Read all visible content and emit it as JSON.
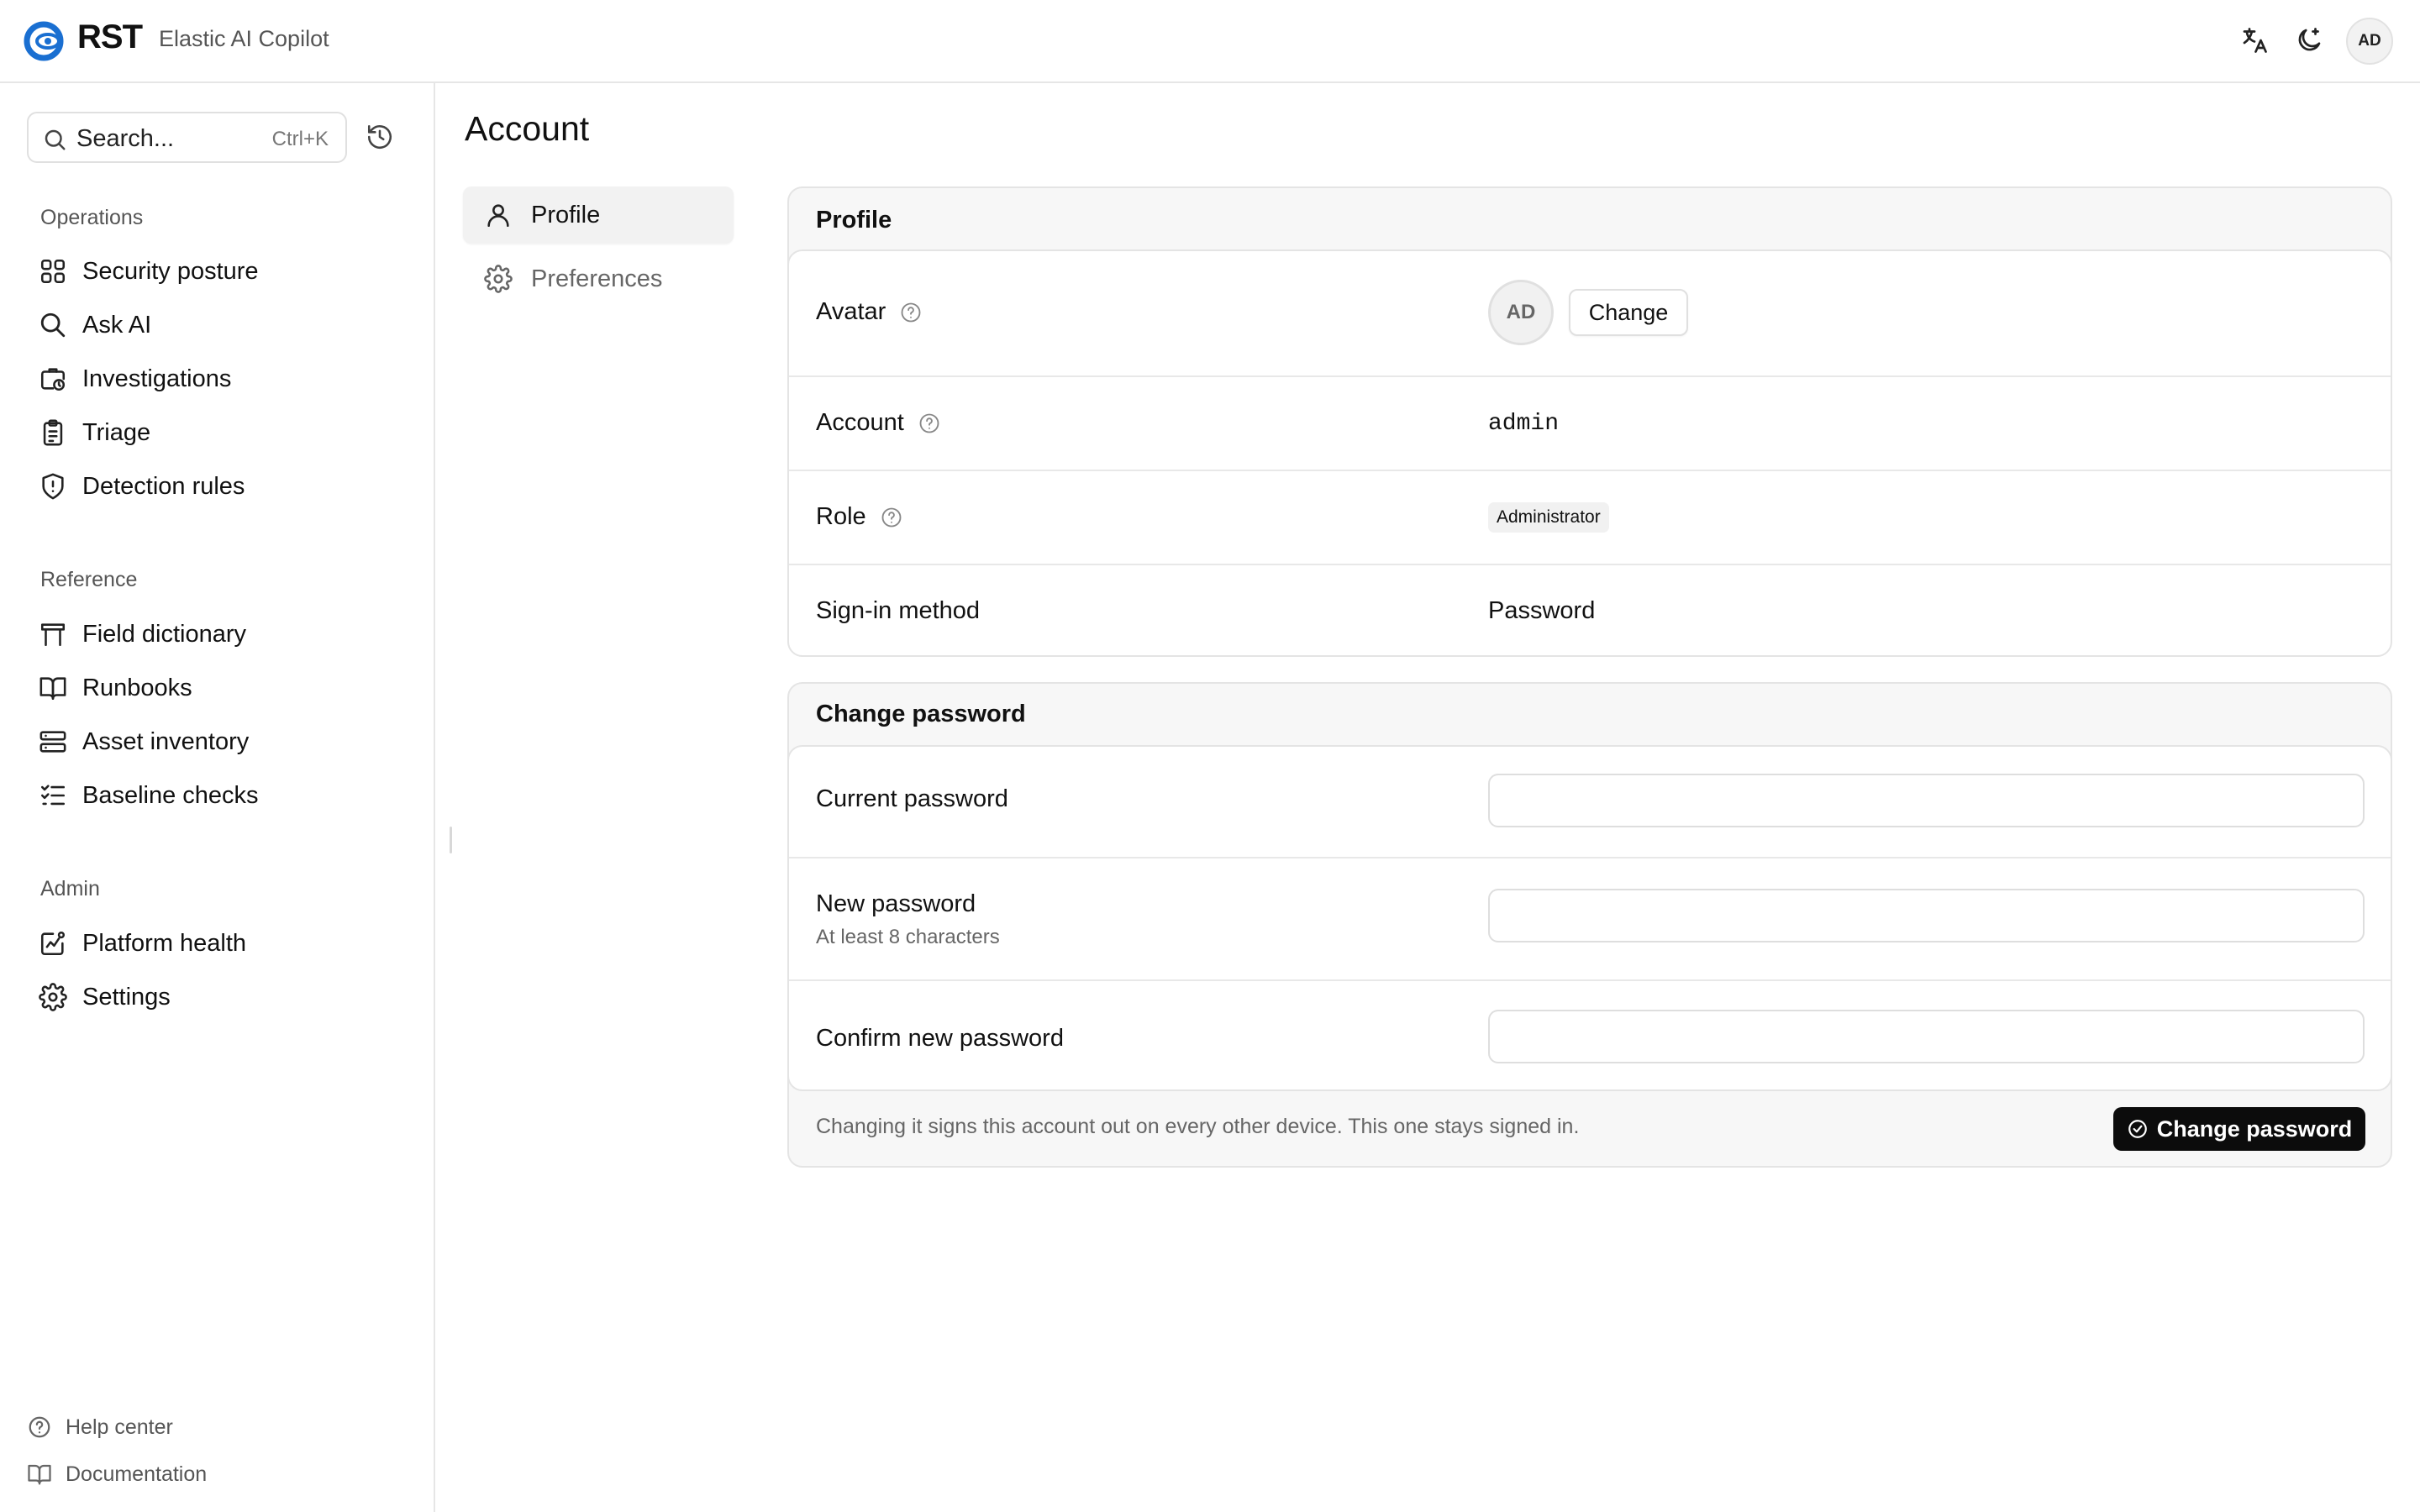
{
  "header": {
    "logo_text": "RST",
    "app_name": "Elastic AI Copilot",
    "icons": [
      "translate-icon",
      "theme-toggle-icon"
    ],
    "user_initials": "AD"
  },
  "sidebar": {
    "search": {
      "placeholder": "Search...",
      "shortcut": "Ctrl+K"
    },
    "sections": [
      {
        "label": "Operations",
        "items": [
          {
            "label": "Security posture",
            "icon": "grid-icon"
          },
          {
            "label": "Ask AI",
            "icon": "search-icon"
          },
          {
            "label": "Investigations",
            "icon": "investigation-icon"
          },
          {
            "label": "Triage",
            "icon": "clipboard-icon"
          },
          {
            "label": "Detection rules",
            "icon": "shield-alert-icon"
          }
        ]
      },
      {
        "label": "Reference",
        "items": [
          {
            "label": "Field dictionary",
            "icon": "table-icon"
          },
          {
            "label": "Runbooks",
            "icon": "book-icon"
          },
          {
            "label": "Asset inventory",
            "icon": "server-icon"
          },
          {
            "label": "Baseline checks",
            "icon": "checklist-icon"
          }
        ]
      },
      {
        "label": "Admin",
        "items": [
          {
            "label": "Platform health",
            "icon": "health-chart-icon"
          },
          {
            "label": "Settings",
            "icon": "gear-icon"
          }
        ]
      }
    ],
    "footer": [
      {
        "label": "Help center",
        "icon": "help-circle-icon"
      },
      {
        "label": "Documentation",
        "icon": "book-open-icon"
      }
    ]
  },
  "main": {
    "title": "Account",
    "subnav": [
      {
        "label": "Profile",
        "icon": "user-icon",
        "active": true
      },
      {
        "label": "Preferences",
        "icon": "gear-icon",
        "active": false
      }
    ],
    "profile_card": {
      "title": "Profile",
      "avatar": {
        "label": "Avatar",
        "initials": "AD",
        "button": "Change"
      },
      "account": {
        "label": "Account",
        "value": "admin"
      },
      "role": {
        "label": "Role",
        "value": "Administrator"
      },
      "signin": {
        "label": "Sign-in method",
        "value": "Password"
      }
    },
    "password_card": {
      "title": "Change password",
      "current": {
        "label": "Current password",
        "value": ""
      },
      "new": {
        "label": "New password",
        "hint": "At least 8 characters",
        "value": ""
      },
      "confirm": {
        "label": "Confirm new password",
        "value": ""
      },
      "note": "Changing it signs this account out on every other device. This one stays signed in.",
      "submit": "Change password"
    }
  },
  "colors": {
    "primary_button": "#0c0c0c",
    "logo_blue": "#1a6fd1",
    "border": "#e4e4e4"
  }
}
